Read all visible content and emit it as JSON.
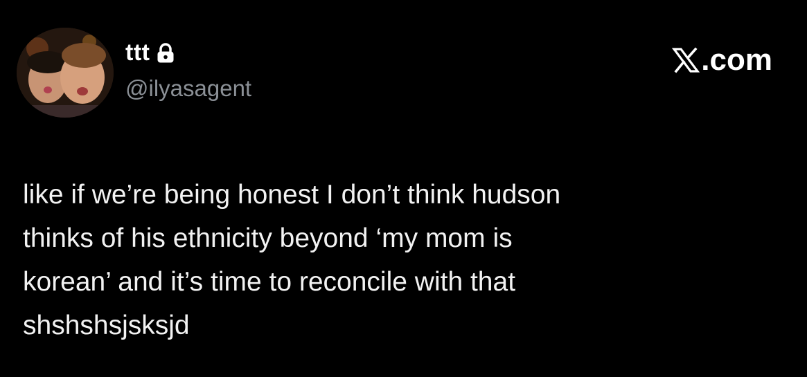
{
  "author": {
    "display_name": "ttt",
    "handle": "@ilyasagent",
    "protected_icon": "lock-icon",
    "avatar_icon": "profile-photo"
  },
  "brand": {
    "icon": "x-logo-icon",
    "suffix": ".com"
  },
  "tweet": {
    "lines": [
      "like if we’re being honest I don’t think hudson",
      "thinks of his ethnicity beyond ‘my mom is",
      "korean’ and it’s time to reconcile with that",
      "shshshsjsksjd"
    ]
  },
  "colors": {
    "background": "#000000",
    "text_primary": "#ffffff",
    "text_secondary": "#8b9096"
  }
}
